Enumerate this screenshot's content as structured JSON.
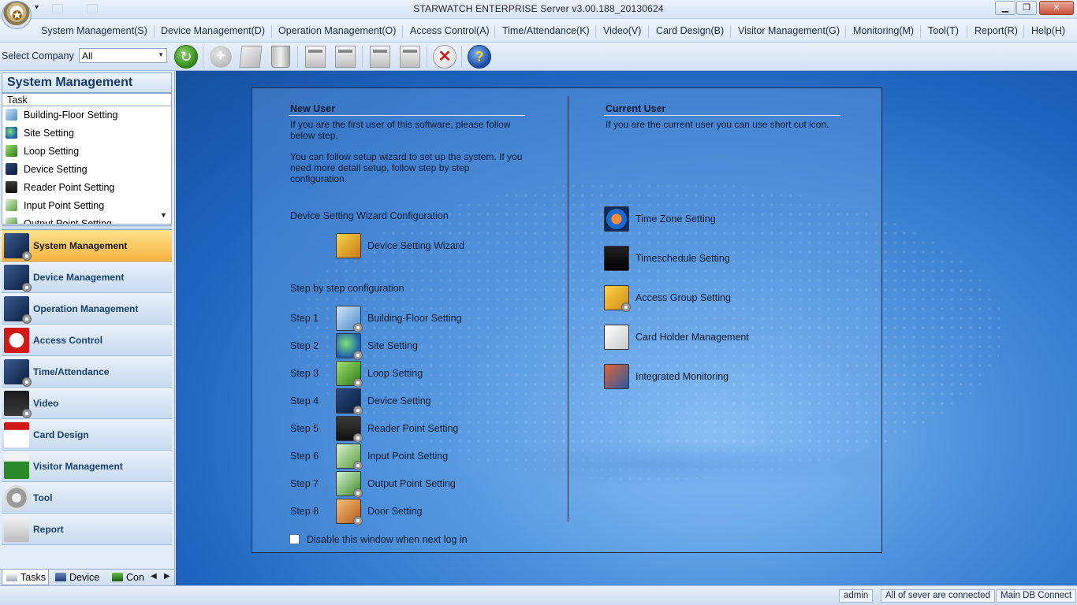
{
  "window": {
    "title": "STARWATCH ENTERPRISE Server v3.00.188_20130624",
    "min": "▁",
    "max": "❐",
    "close": "✕"
  },
  "menu": [
    "System Management(S)",
    "Device Management(D)",
    "Operation Management(O)",
    "Access Control(A)",
    "Time/Attendance(K)",
    "Video(V)",
    "Card Design(B)",
    "Visitor Management(G)",
    "Monitoring(M)",
    "Tool(T)",
    "Report(R)",
    "Help(H)"
  ],
  "toolbar": {
    "company_label": "Select Company",
    "company_value": "All",
    "refresh_glyph": "↻",
    "add_glyph": "+",
    "stop_glyph": "✕",
    "help_glyph": "?"
  },
  "left_panel": {
    "title": "System Management",
    "task_header": "Task",
    "tasks": [
      "Building-Floor Setting",
      "Site Setting",
      "Loop Setting",
      "Device Setting",
      "Reader Point Setting",
      "Input Point Setting",
      "Output Point Setting"
    ],
    "nav": [
      "System Management",
      "Device Management",
      "Operation Management",
      "Access Control",
      "Time/Attendance",
      "Video",
      "Card Design",
      "Visitor Management",
      "Tool",
      "Report"
    ],
    "active_nav": "System Management",
    "bottom_tabs": [
      "Tasks",
      "Device",
      "Con"
    ]
  },
  "main": {
    "new_user": {
      "title": "New User",
      "text1": "If you are the first user of this software, please follow below step.",
      "text2": " You can follow setup wizard to set up the system. If you need more detail setup, follow step by step configuration.",
      "wizard_heading": "Device Setting Wizard Configuration",
      "wizard_label": "Device Setting Wizard",
      "steps_heading": "Step by step configuration",
      "steps": [
        {
          "step": "Step 1",
          "label": "Building-Floor Setting"
        },
        {
          "step": "Step 2",
          "label": "Site Setting"
        },
        {
          "step": "Step 3",
          "label": "Loop Setting"
        },
        {
          "step": "Step 4",
          "label": "Device Setting"
        },
        {
          "step": "Step 5",
          "label": "Reader Point Setting"
        },
        {
          "step": "Step 6",
          "label": "Input Point Setting"
        },
        {
          "step": "Step 7",
          "label": "Output Point Setting"
        },
        {
          "step": "Step 8",
          "label": "Door Setting"
        }
      ]
    },
    "current_user": {
      "title": "Current User",
      "text": "If you are the current user you can use short cut icon.",
      "shortcuts": [
        "Time Zone Setting",
        "Timeschedule Setting",
        "Access Group Setting",
        "Card Holder Management",
        "Integrated Monitoring"
      ]
    },
    "disable_label": "Disable this window when next log in",
    "disable_checked": false
  },
  "status": {
    "user": "admin",
    "server": "All of sever are connected",
    "db": "Main DB Connect"
  }
}
